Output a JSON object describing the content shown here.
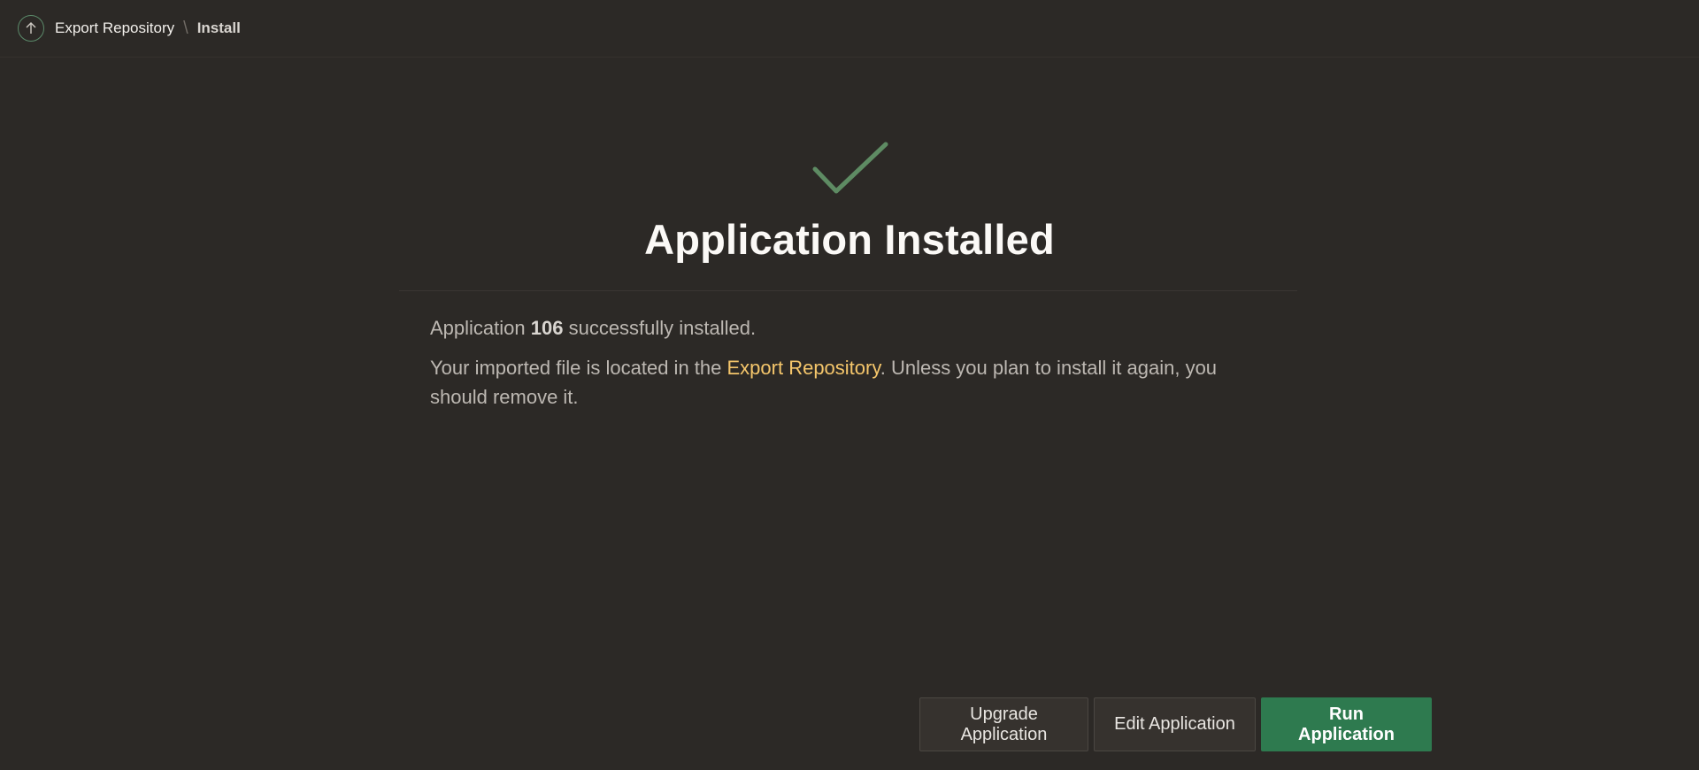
{
  "breadcrumb": {
    "parent_label": "Export Repository",
    "separator": "\\",
    "current_label": "Install"
  },
  "status": {
    "title": "Application Installed",
    "icon": "check-icon",
    "icon_color": "#5e8b63"
  },
  "message": {
    "line1_prefix": "Application ",
    "app_id": "106",
    "line1_suffix": " successfully installed.",
    "line2_prefix": "Your imported file is located in the ",
    "line2_link": "Export Repository",
    "line2_suffix": ". Unless you plan to install it again, you should remove it."
  },
  "actions": {
    "upgrade_label": "Upgrade Application",
    "edit_label": "Edit Application",
    "run_label": "Run Application"
  },
  "colors": {
    "background": "#2c2926",
    "link": "#f5c66b",
    "primary_button": "#2e7a4f"
  }
}
